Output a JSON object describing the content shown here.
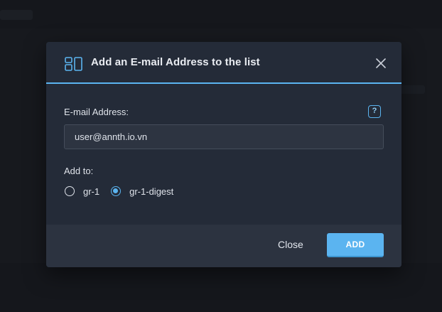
{
  "dialog": {
    "title": "Add an E-mail Address to the list",
    "close_icon": "close-icon",
    "header_icon": "list-layout-icon"
  },
  "email": {
    "label": "E-mail Address:",
    "value": "user@annth.io.vn",
    "help_label": "?"
  },
  "add_to": {
    "label": "Add to:",
    "options": [
      {
        "label": "gr-1",
        "selected": false
      },
      {
        "label": "gr-1-digest",
        "selected": true
      }
    ]
  },
  "footer": {
    "close_label": "Close",
    "add_label": "ADD"
  },
  "colors": {
    "accent": "#5bb4f0",
    "dialog_bg": "#242b38",
    "footer_bg": "#2c3340"
  }
}
